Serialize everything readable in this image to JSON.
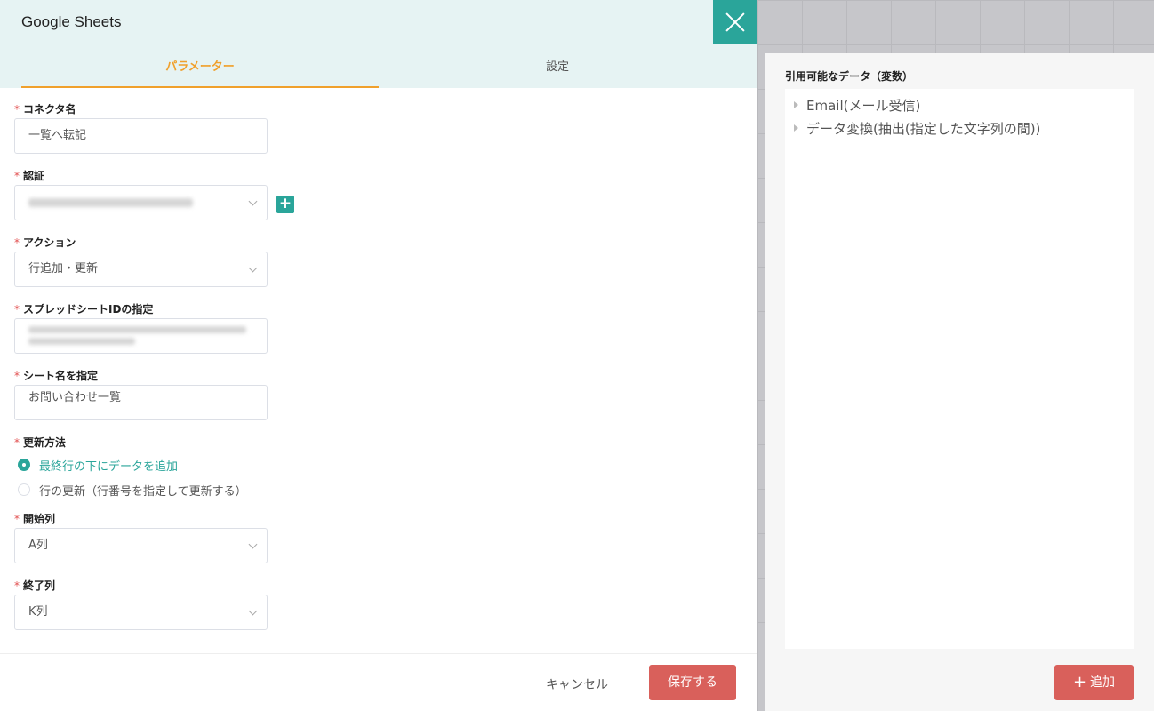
{
  "header": {
    "title": "Google Sheets"
  },
  "tabs": [
    {
      "label": "パラメーター",
      "active": true
    },
    {
      "label": "設定",
      "active": false
    }
  ],
  "form": {
    "connector_name": {
      "label": "コネクタ名",
      "value": "一覧へ転記"
    },
    "auth": {
      "label": "認証"
    },
    "action": {
      "label": "アクション",
      "value": "行追加・更新"
    },
    "spreadsheet_id": {
      "label": "スプレッドシートIDの指定"
    },
    "sheet_name": {
      "label": "シート名を指定",
      "value": "お問い合わせ一覧"
    },
    "update_method": {
      "label": "更新方法",
      "options": [
        "最終行の下にデータを追加",
        "行の更新（行番号を指定して更新する）"
      ],
      "selected": 0
    },
    "start_col": {
      "label": "開始列",
      "value": "A列"
    },
    "end_col": {
      "label": "終了列",
      "value": "K列"
    }
  },
  "footer": {
    "cancel_label": "キャンセル",
    "save_label": "保存する"
  },
  "right_panel": {
    "title": "引用可能なデータ（変数）",
    "items": [
      "Email(メール受信)",
      "データ変換(抽出(指定した文字列の間))"
    ],
    "add_label": "追加"
  },
  "colors": {
    "accent": "#2aa59a",
    "tab_active": "#f0a02c",
    "danger": "#d9605b"
  }
}
